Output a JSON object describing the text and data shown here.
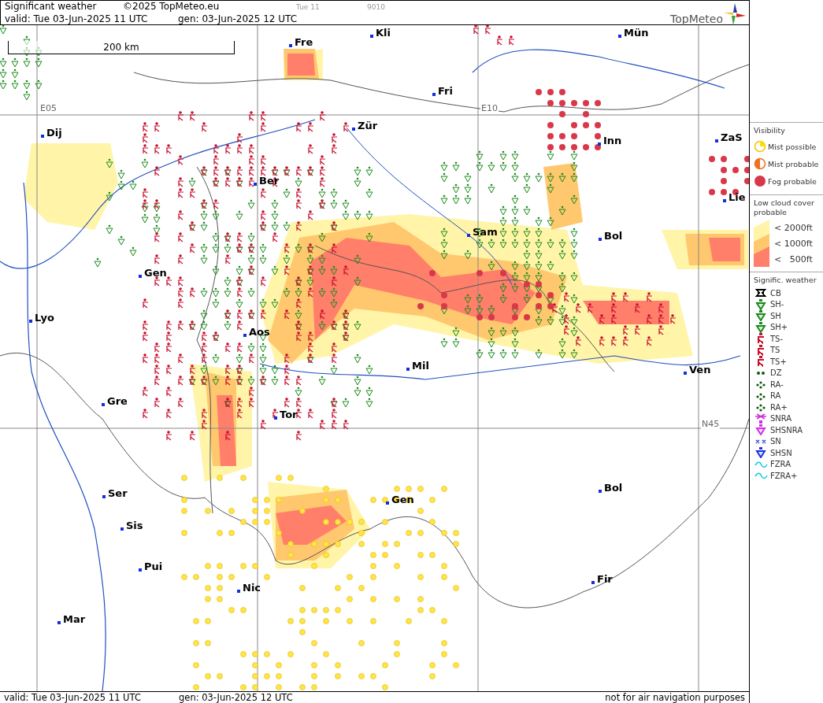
{
  "header": {
    "title": "Significant weather",
    "copyright": "©2025 TopMeteo.eu",
    "run_day": "Tue 11",
    "code": "9010",
    "valid": "valid:  Tue  03-Jun-2025  11 UTC",
    "generated": "gen: 03-Jun-2025 12 UTC",
    "logo": "TopMeteo"
  },
  "map": {
    "scale": "200 km",
    "grid_labels": [
      "E05",
      "E10",
      "N45"
    ],
    "cities": [
      "Fre",
      "Kli",
      "Mün",
      "Fri",
      "Dij",
      "Zür",
      "Inn",
      "ZaS",
      "Lie",
      "Ber",
      "Sam",
      "Bol",
      "Gen",
      "Lyo",
      "Aos",
      "Mil",
      "Ven",
      "Gre",
      "Tor",
      "Ser",
      "Gen",
      "Bol",
      "Sis",
      "Pui",
      "Nic",
      "Fir",
      "Mar"
    ]
  },
  "legend": {
    "visibility": {
      "title": "Visibility",
      "items": [
        {
          "kind": "possible",
          "label": "Mist possible"
        },
        {
          "kind": "probable",
          "label": "Mist probable"
        },
        {
          "kind": "fog",
          "label": "Fog probable"
        }
      ]
    },
    "low_cloud": {
      "title": "Low cloud cover probable",
      "levels": [
        {
          "label": "< 2000ft",
          "color": "#fff4a8"
        },
        {
          "label": "< 1000ft",
          "color": "#ffc86e"
        },
        {
          "label": "<   500ft",
          "color": "#ff7f6a"
        }
      ]
    },
    "weather": {
      "title": "Signific. weather",
      "items": [
        {
          "kind": "cb",
          "label": "CB",
          "color": "#000000"
        },
        {
          "kind": "shower",
          "label": "SH-",
          "color": "#1a8a1a"
        },
        {
          "kind": "shower",
          "label": "SH",
          "color": "#1a8a1a"
        },
        {
          "kind": "shower",
          "label": "SH+",
          "color": "#1a8a1a"
        },
        {
          "kind": "thunder",
          "label": "TS-",
          "color": "#c8102e"
        },
        {
          "kind": "thunder",
          "label": "TS",
          "color": "#c8102e"
        },
        {
          "kind": "thunder",
          "label": "TS+",
          "color": "#c8102e"
        },
        {
          "kind": "drizzle",
          "label": "DZ",
          "color": "#0a5a0a"
        },
        {
          "kind": "rain",
          "label": "RA-",
          "color": "#0a5a0a"
        },
        {
          "kind": "rain",
          "label": "RA",
          "color": "#0a5a0a"
        },
        {
          "kind": "rain",
          "label": "RA+",
          "color": "#0a5a0a"
        },
        {
          "kind": "snowrain",
          "label": "SNRA",
          "color": "#d030e0"
        },
        {
          "kind": "shower",
          "label": "SHSNRA",
          "color": "#d030e0"
        },
        {
          "kind": "snow",
          "label": "SN",
          "color": "#1a30e0"
        },
        {
          "kind": "shower",
          "label": "SHSN",
          "color": "#1a30e0"
        },
        {
          "kind": "freezing",
          "label": "FZRA",
          "color": "#10c8e8"
        },
        {
          "kind": "freezing",
          "label": "FZRA+",
          "color": "#10c8e8"
        }
      ]
    }
  },
  "footer": {
    "valid": "valid:  Tue  03-Jun-2025  11 UTC",
    "generated": "gen: 03-Jun-2025 12 UTC",
    "disclaimer": "not for air navigation purposes"
  }
}
